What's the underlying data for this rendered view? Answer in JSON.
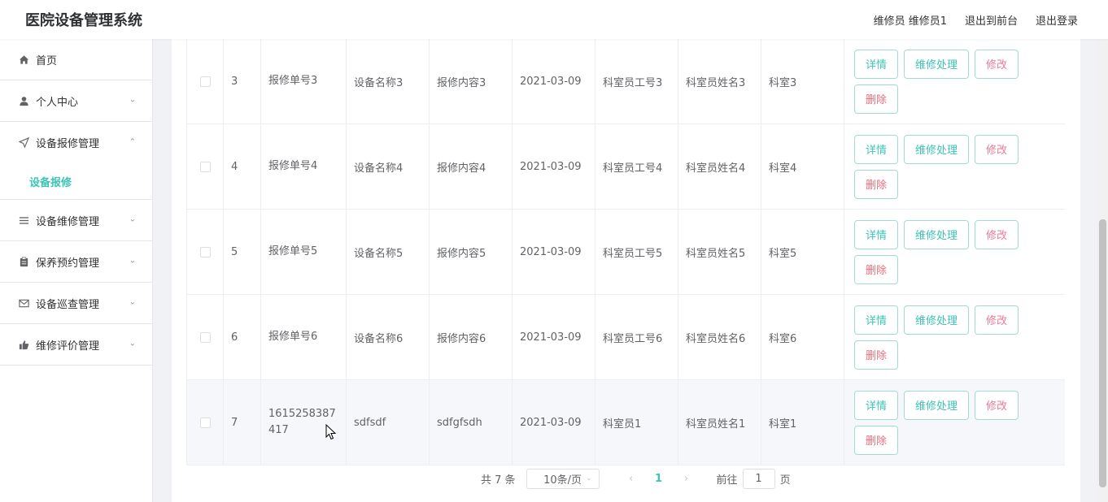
{
  "header": {
    "title": "医院设备管理系统",
    "user": "维修员 维修员1",
    "back_front": "退出到前台",
    "logout": "退出登录"
  },
  "sidebar": {
    "items": [
      {
        "label": "首页",
        "icon": "home-icon"
      },
      {
        "label": "个人中心",
        "icon": "user-icon"
      },
      {
        "label": "设备报修管理",
        "icon": "send-icon",
        "open": true,
        "sub": "设备报修"
      },
      {
        "label": "设备维修管理",
        "icon": "list-icon"
      },
      {
        "label": "保养预约管理",
        "icon": "clipboard-icon"
      },
      {
        "label": "设备巡查管理",
        "icon": "mail-icon"
      },
      {
        "label": "维修评价管理",
        "icon": "thumb-icon"
      }
    ]
  },
  "table": {
    "rows": [
      {
        "idx": "3",
        "no": "报修单号3",
        "name": "设备名称3",
        "content": "报修内容3",
        "date": "2021-03-09",
        "emp_no": "科室员工号3",
        "emp_name": "科室员姓名3",
        "dept": "科室3"
      },
      {
        "idx": "4",
        "no": "报修单号4",
        "name": "设备名称4",
        "content": "报修内容4",
        "date": "2021-03-09",
        "emp_no": "科室员工号4",
        "emp_name": "科室员姓名4",
        "dept": "科室4"
      },
      {
        "idx": "5",
        "no": "报修单号5",
        "name": "设备名称5",
        "content": "报修内容5",
        "date": "2021-03-09",
        "emp_no": "科室员工号5",
        "emp_name": "科室员姓名5",
        "dept": "科室5"
      },
      {
        "idx": "6",
        "no": "报修单号6",
        "name": "设备名称6",
        "content": "报修内容6",
        "date": "2021-03-09",
        "emp_no": "科室员工号6",
        "emp_name": "科室员姓名6",
        "dept": "科室6"
      },
      {
        "idx": "7",
        "no": "1615258387417",
        "name": "sdfsdf",
        "content": "sdfgfsdh",
        "date": "2021-03-09",
        "emp_no": "科室员1",
        "emp_name": "科室员姓名1",
        "dept": "科室1"
      }
    ],
    "actions": {
      "detail": "详情",
      "repair": "维修处理",
      "edit": "修改",
      "delete": "删除"
    }
  },
  "pager": {
    "total": "共 7 条",
    "page_size": "10条/页",
    "current_page": "1",
    "goto_label": "前往",
    "goto_value": "1",
    "page_suffix": "页",
    "prev_icon": "chevron-left-icon",
    "next_icon": "chevron-right-icon"
  },
  "colors": {
    "accent": "#3cc4b4",
    "danger": "#ee6f7c",
    "border": "#ebeef5"
  }
}
